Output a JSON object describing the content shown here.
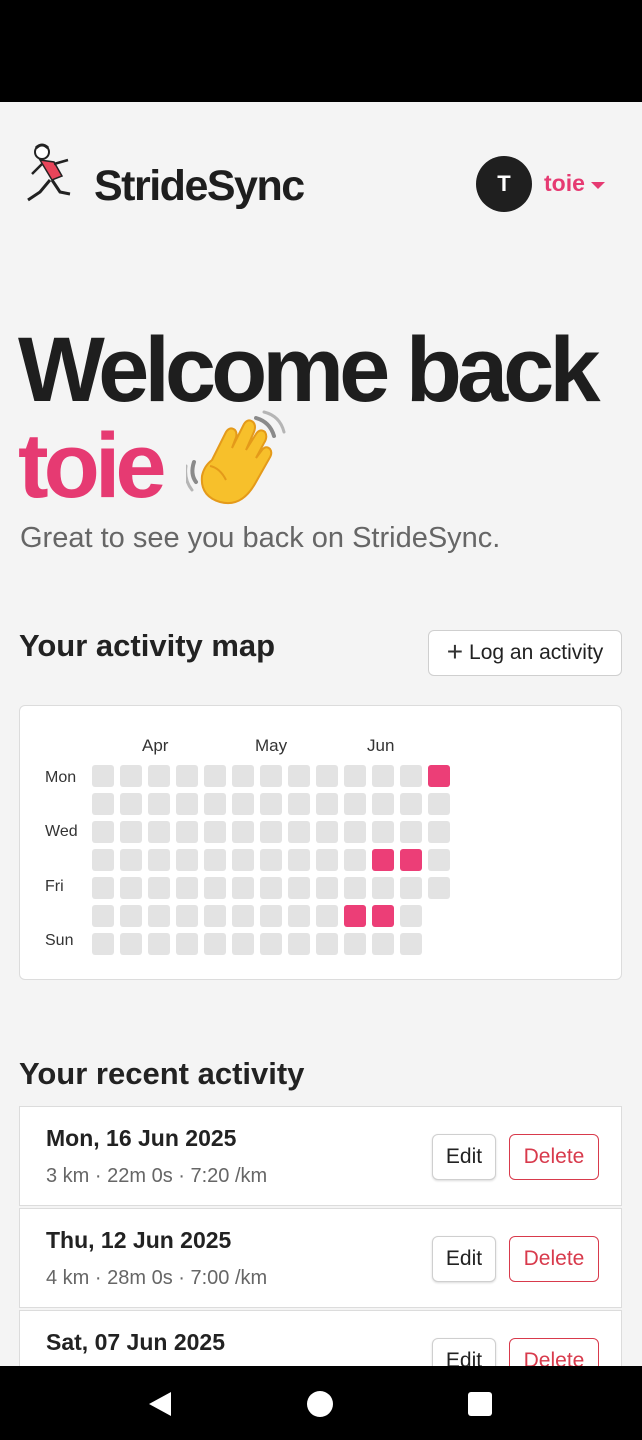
{
  "app": {
    "brand": "StrideSync"
  },
  "user": {
    "avatar_initial": "T",
    "username": "toie"
  },
  "hero": {
    "welcome_line": "Welcome back",
    "name": "toie",
    "subtitle": "Great to see you back on StrideSync."
  },
  "activity_map": {
    "title": "Your activity map",
    "log_button": "Log an activity",
    "months": [
      "Apr",
      "May",
      "Jun"
    ],
    "day_labels": [
      "Mon",
      "Wed",
      "Fri",
      "Sun"
    ],
    "columns": 13,
    "active_cells": [
      {
        "week": 12,
        "day": 0
      },
      {
        "week": 10,
        "day": 3
      },
      {
        "week": 11,
        "day": 3
      },
      {
        "week": 9,
        "day": 5
      },
      {
        "week": 10,
        "day": 5
      }
    ],
    "colors": {
      "empty": "#e3e3e3",
      "active": "#ec3e77"
    }
  },
  "recent": {
    "title": "Your recent activity",
    "edit_label": "Edit",
    "delete_label": "Delete",
    "items": [
      {
        "date": "Mon, 16 Jun 2025",
        "stats": "3 km · 22m 0s · 7:20 /km"
      },
      {
        "date": "Thu, 12 Jun 2025",
        "stats": "4 km · 28m 0s · 7:00 /km"
      },
      {
        "date": "Sat, 07 Jun 2025",
        "stats": ""
      }
    ]
  },
  "theme": {
    "accent": "#e63a72",
    "danger": "#d83a4c"
  }
}
